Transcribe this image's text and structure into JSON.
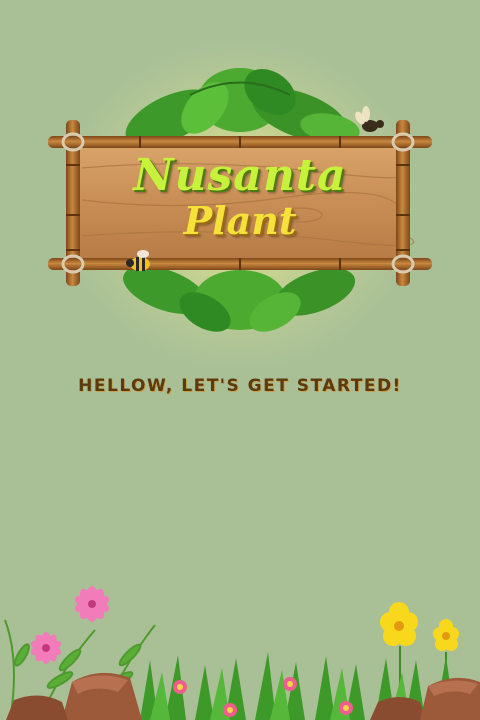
{
  "logo": {
    "title": "Nusanta",
    "subtitle": "Plant"
  },
  "greeting": "HELLOW, LET'S GET STARTED!",
  "colors": {
    "background": "#a9c097",
    "title": "#c7f23b",
    "subtitle": "#f4e13a",
    "greeting": "#5a3a0e",
    "wood": "#c7925a",
    "bamboo": "#a8662b"
  },
  "icons": [
    "leaf-icon",
    "bee-icon",
    "bug-icon",
    "flower-icon",
    "rock-icon",
    "fern-icon",
    "grass-icon"
  ]
}
